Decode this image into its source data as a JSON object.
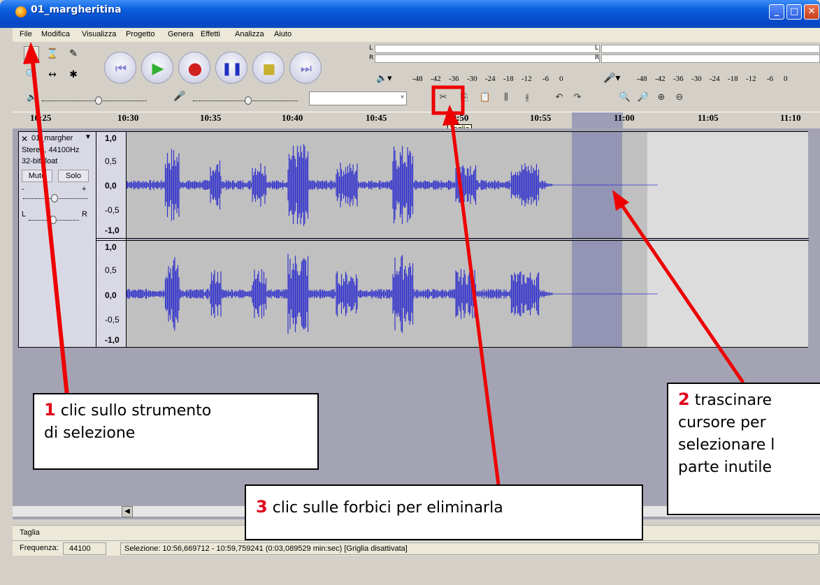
{
  "window": {
    "title": "01_margheritina"
  },
  "menu": [
    "File",
    "Modifica",
    "Visualizza",
    "Progetto",
    "Genera",
    "Effetti",
    "Analizza",
    "Aiuto"
  ],
  "meters": {
    "play_L": "L",
    "play_R": "R",
    "rec_L": "L",
    "rec_R": "R",
    "scale_play": [
      "-48",
      "-42",
      "-36",
      "-30",
      "-24",
      "-18",
      "-12",
      "-6",
      "0"
    ],
    "scale_rec": [
      "-48",
      "-42",
      "-36",
      "-30",
      "-24",
      "-18",
      "-12",
      "-6",
      "0"
    ]
  },
  "timeline": {
    "labels": [
      "10:25",
      "10:30",
      "10:35",
      "10:40",
      "10:45",
      "10:50",
      "10:55",
      "11:00",
      "11:05",
      "11:10"
    ]
  },
  "tooltip": "Taglia",
  "track": {
    "name": "01_margher",
    "format": "Stereo, 44100Hz",
    "bitdepth": "32-bit float",
    "mute_label": "Muto",
    "solo_label": "Solo",
    "gain_minus": "-",
    "gain_plus": "+",
    "pan_left": "L",
    "pan_right": "R",
    "ruler_top": [
      "1,0",
      "0,5",
      "0,0",
      "-0,5",
      "-1,0"
    ],
    "ruler_bottom": [
      "1,0",
      "0,5",
      "0,0",
      "-0,5",
      "-1,0"
    ]
  },
  "status": {
    "action": "Taglia",
    "rate_label": "Frequenza:",
    "rate_value": "44100",
    "selection": "Selezione: 10:56,669712 - 10:59,759241 (0:03,089529 min:sec)  [Griglia disattivata]"
  },
  "callouts": {
    "c1_num": "1",
    "c1_text_a": " clic sullo strumento",
    "c1_text_b": "di selezione",
    "c2_num": "2",
    "c2_text_a": " trascinare",
    "c2_text_b": "cursore per",
    "c2_text_c": "selezionare l",
    "c2_text_d": "parte inutile",
    "c3_num": "3",
    "c3_text": " clic sulle forbici per eliminarla"
  },
  "colors": {
    "waveform": "#3333cc",
    "selection": "#8a8aa8",
    "annotation": "#ee0000"
  }
}
